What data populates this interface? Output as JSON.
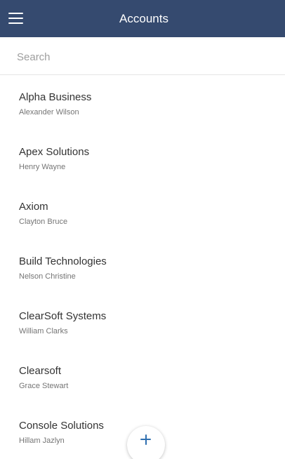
{
  "header": {
    "title": "Accounts",
    "menu_icon": "hamburger-menu-icon"
  },
  "search": {
    "placeholder": "Search",
    "value": ""
  },
  "accounts": [
    {
      "name": "Alpha Business",
      "contact": "Alexander Wilson"
    },
    {
      "name": "Apex Solutions",
      "contact": "Henry Wayne"
    },
    {
      "name": "Axiom",
      "contact": "Clayton Bruce"
    },
    {
      "name": "Build Technologies",
      "contact": "Nelson Christine"
    },
    {
      "name": "ClearSoft Systems",
      "contact": "William Clarks"
    },
    {
      "name": "Clearsoft",
      "contact": "Grace Stewart"
    },
    {
      "name": "Console Solutions",
      "contact": "Hillam Jazlyn"
    }
  ],
  "fab": {
    "icon": "plus-icon"
  },
  "colors": {
    "header_bg": "#354a6f",
    "accent": "#2f6fb0"
  }
}
